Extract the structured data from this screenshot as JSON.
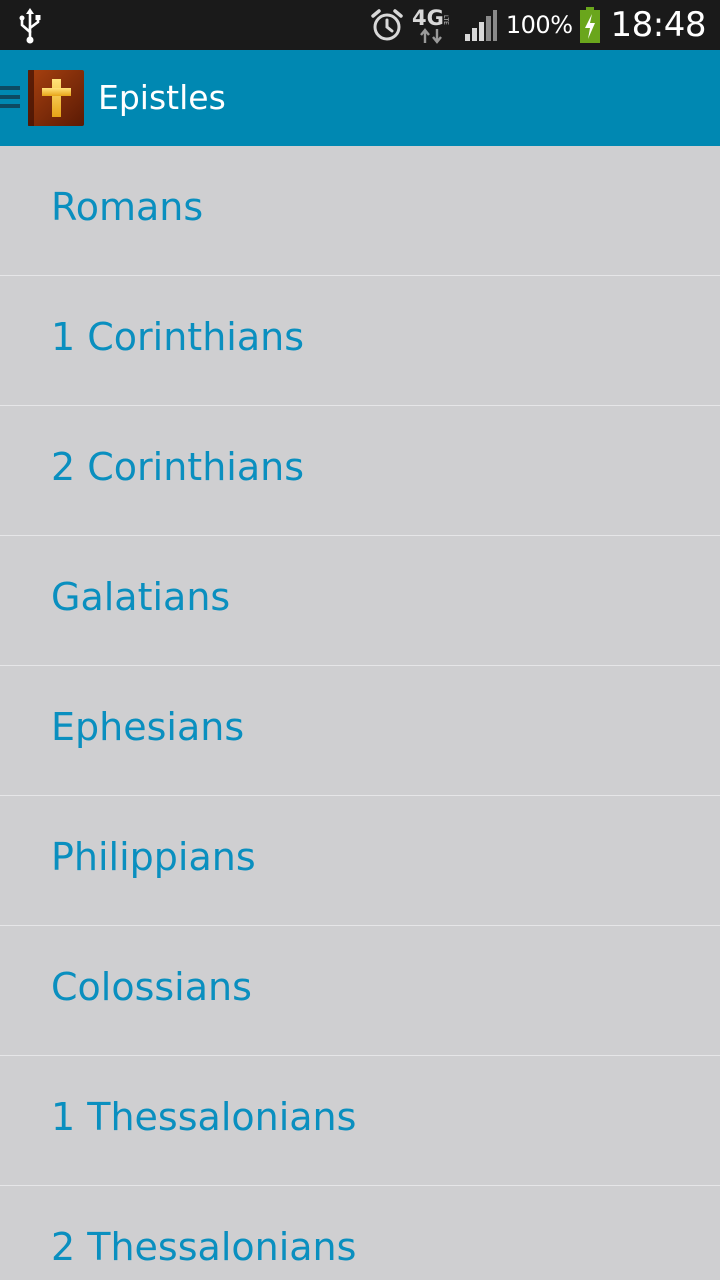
{
  "status_bar": {
    "icons": [
      "usb-icon",
      "alarm-icon",
      "network-4g-lte-icon",
      "signal-icon",
      "battery-charging-icon"
    ],
    "network_label": "4G",
    "battery_percent": "100%",
    "time": "18:48"
  },
  "action_bar": {
    "title": "Epistles",
    "app_icon": "cross-book-icon",
    "drawer_icon": "drawer-menu-icon",
    "color": "#0088b2"
  },
  "books": [
    {
      "label": "Romans"
    },
    {
      "label": "1 Corinthians"
    },
    {
      "label": "2 Corinthians"
    },
    {
      "label": "Galatians"
    },
    {
      "label": "Ephesians"
    },
    {
      "label": "Philippians"
    },
    {
      "label": "Colossians"
    },
    {
      "label": "1 Thessalonians"
    },
    {
      "label": "2 Thessalonians"
    }
  ],
  "colors": {
    "list_text": "#0a8fbf",
    "list_background": "#cfcfd1",
    "divider": "#e6e6e8"
  }
}
